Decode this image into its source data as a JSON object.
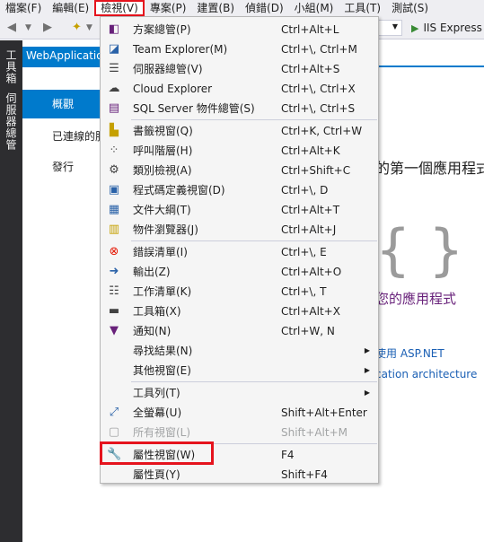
{
  "menubar": {
    "items": [
      "檔案(F)",
      "編輯(E)",
      "檢視(V)",
      "專案(P)",
      "建置(B)",
      "偵錯(D)",
      "小組(M)",
      "工具(T)",
      "測試(S)"
    ]
  },
  "toolbar": {
    "run_target": "IIS Express"
  },
  "left_strip": {
    "toolbox": "工具箱",
    "server_explorer": "伺服器總管"
  },
  "document_tab": {
    "title": "WebApplication"
  },
  "page": {
    "nav_selected": "概觀",
    "nav_connected": "已連線的服",
    "nav_publish": "發行",
    "heading_fragment": "的第一個應用程式",
    "brace_glyph": "{ }",
    "app_fragment": "您的應用程式",
    "link1": "使用 ASP.NET",
    "link2": "cation architecture"
  },
  "view_menu": {
    "items": [
      {
        "icon": "solution-explorer-icon",
        "label": "方案總管(P)",
        "shortcut": "Ctrl+Alt+L"
      },
      {
        "icon": "team-explorer-icon",
        "label": "Team Explorer(M)",
        "shortcut": "Ctrl+\\, Ctrl+M"
      },
      {
        "icon": "server-explorer-icon",
        "label": "伺服器總管(V)",
        "shortcut": "Ctrl+Alt+S"
      },
      {
        "icon": "cloud-icon",
        "label": "Cloud Explorer",
        "shortcut": "Ctrl+\\, Ctrl+X"
      },
      {
        "icon": "sql-server-icon",
        "label": "SQL Server 物件總管(S)",
        "shortcut": "Ctrl+\\, Ctrl+S"
      },
      {
        "icon": "bookmark-icon",
        "label": "書籤視窗(Q)",
        "shortcut": "Ctrl+K, Ctrl+W"
      },
      {
        "icon": "call-hierarchy-icon",
        "label": "呼叫階層(H)",
        "shortcut": "Ctrl+Alt+K"
      },
      {
        "icon": "class-view-icon",
        "label": "類別檢視(A)",
        "shortcut": "Ctrl+Shift+C"
      },
      {
        "icon": "code-definition-icon",
        "label": "程式碼定義視窗(D)",
        "shortcut": "Ctrl+\\, D"
      },
      {
        "icon": "document-outline-icon",
        "label": "文件大綱(T)",
        "shortcut": "Ctrl+Alt+T"
      },
      {
        "icon": "object-browser-icon",
        "label": "物件瀏覽器(J)",
        "shortcut": "Ctrl+Alt+J"
      },
      {
        "icon": "error-list-icon",
        "label": "錯誤清單(I)",
        "shortcut": "Ctrl+\\, E"
      },
      {
        "icon": "output-icon",
        "label": "輸出(Z)",
        "shortcut": "Ctrl+Alt+O"
      },
      {
        "icon": "task-list-icon",
        "label": "工作清單(K)",
        "shortcut": "Ctrl+\\, T"
      },
      {
        "icon": "toolbox-icon",
        "label": "工具箱(X)",
        "shortcut": "Ctrl+Alt+X"
      },
      {
        "icon": "notification-icon",
        "label": "通知(N)",
        "shortcut": "Ctrl+W, N"
      },
      {
        "icon": "",
        "label": "尋找結果(N)",
        "shortcut": ""
      },
      {
        "icon": "",
        "label": "其他視窗(E)",
        "shortcut": ""
      },
      {
        "icon": "",
        "label": "工具列(T)",
        "shortcut": ""
      },
      {
        "icon": "full-screen-icon",
        "label": "全螢幕(U)",
        "shortcut": "Shift+Alt+Enter"
      },
      {
        "icon": "all-windows-icon",
        "label": "所有視窗(L)",
        "shortcut": "Shift+Alt+M"
      },
      {
        "icon": "wrench-icon",
        "label": "屬性視窗(W)",
        "shortcut": "F4"
      },
      {
        "icon": "",
        "label": "屬性頁(Y)",
        "shortcut": "Shift+F4"
      }
    ]
  }
}
